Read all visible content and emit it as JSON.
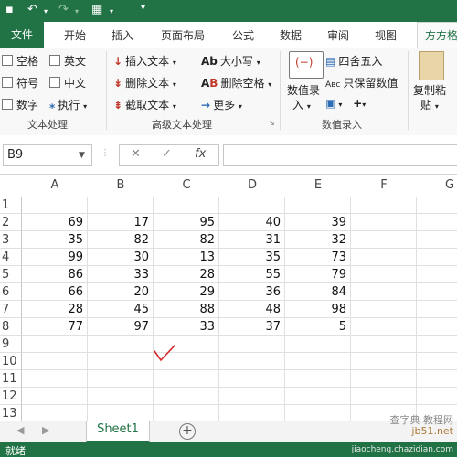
{
  "ribbon_tabs": {
    "file": "文件",
    "home": "开始",
    "insert": "插入",
    "page_layout": "页面布局",
    "formulas": "公式",
    "data": "数据",
    "review": "审阅",
    "view": "视图",
    "addin": "方方格"
  },
  "text_processing": {
    "space": "空格",
    "english": "英文",
    "symbol": "符号",
    "chinese": "中文",
    "number": "数字",
    "execute": "执行",
    "group_label": "文本处理"
  },
  "advanced_text": {
    "insert_text": "插入文本",
    "delete_text": "删除文本",
    "extract_text": "截取文本",
    "case": "大小写",
    "delete_space": "删除空格",
    "more": "更多",
    "group_label": "高级文本处理"
  },
  "numeric_entry": {
    "value_entry_line1": "数值录",
    "value_entry_line2": "入",
    "round": "四舍五入",
    "keep_value": "只保留数值",
    "group_label": "数值录入"
  },
  "clipboard": {
    "copy_paste_line1": "复制粘",
    "copy_paste_line2": "贴"
  },
  "formula_bar": {
    "name_box": "B9",
    "cancel": "✕",
    "enter": "✓",
    "fx": "fx",
    "content": ""
  },
  "sheet": {
    "columns": [
      "A",
      "B",
      "C",
      "D",
      "E",
      "F",
      "G"
    ],
    "row_numbers": [
      "1",
      "2",
      "3",
      "4",
      "5",
      "6",
      "7",
      "8",
      "9",
      "10",
      "11",
      "12",
      "13"
    ],
    "rows": [
      [
        "",
        "",
        "",
        "",
        ""
      ],
      [
        "69",
        "17",
        "95",
        "40",
        "39"
      ],
      [
        "35",
        "82",
        "82",
        "31",
        "32"
      ],
      [
        "99",
        "30",
        "13",
        "35",
        "73"
      ],
      [
        "86",
        "33",
        "28",
        "55",
        "79"
      ],
      [
        "66",
        "20",
        "29",
        "36",
        "84"
      ],
      [
        "28",
        "45",
        "88",
        "48",
        "98"
      ],
      [
        "77",
        "97",
        "33",
        "37",
        "5"
      ]
    ]
  },
  "sheet_tabs": {
    "active": "Sheet1",
    "add": "+"
  },
  "status_bar": {
    "ready": "就绪"
  },
  "watermark": {
    "line1": "查字典 教程网",
    "line2": "jb51.net",
    "line3": "jiaocheng.chazidian.com"
  },
  "colors": {
    "excel_green": "#217346",
    "annotation_red": "#d62b2b"
  }
}
